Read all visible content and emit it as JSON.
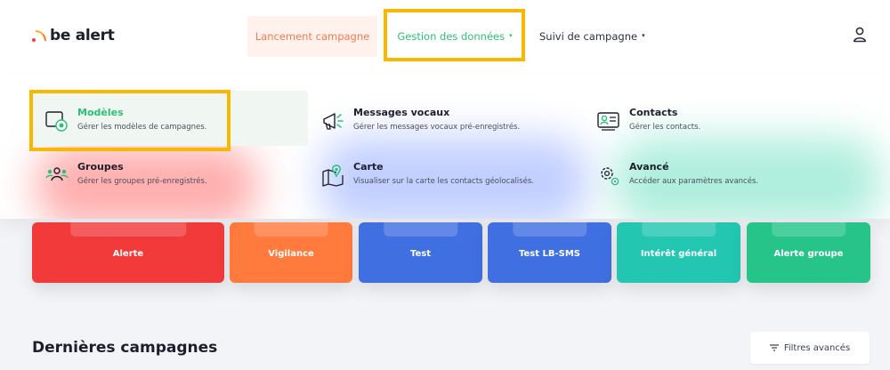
{
  "brand": {
    "logo_text": "be alert"
  },
  "nav": {
    "launch": "Lancement campagne",
    "data": "Gestion des données",
    "follow": "Suivi de campagne",
    "caret": "▾"
  },
  "menu": {
    "items": [
      {
        "title": "Modèles",
        "desc": "Gérer les modèles de campagnes.",
        "icon": "templates-icon"
      },
      {
        "title": "Messages vocaux",
        "desc": "Gérer les messages vocaux pré-enregistrés.",
        "icon": "megaphone-icon"
      },
      {
        "title": "Contacts",
        "desc": "Gérer les contacts.",
        "icon": "contact-card-icon"
      },
      {
        "title": "Groupes",
        "desc": "Gérer les groupes pré-enregistrés.",
        "icon": "group-icon"
      },
      {
        "title": "Carte",
        "desc": "Visualiser sur la carte les contacts géolocalisés.",
        "icon": "map-pin-icon"
      },
      {
        "title": "Avancé",
        "desc": "Accéder aux paramètres avancés.",
        "icon": "gear-icon"
      }
    ]
  },
  "cards": [
    {
      "label": "Alerte",
      "color": "#f23a3a"
    },
    {
      "label": "Vigilance",
      "color": "#ff7a3d"
    },
    {
      "label": "Test",
      "color": "#3f6fe0"
    },
    {
      "label": "Test LB-SMS",
      "color": "#3f6fe0"
    },
    {
      "label": "Intérêt général",
      "color": "#23c6b0"
    },
    {
      "label": "Alerte groupe",
      "color": "#26c489"
    }
  ],
  "section": {
    "title": "Dernières campagnes"
  },
  "filters": {
    "label": "Filtres avancés"
  },
  "colors": {
    "accent_green": "#2cbf78",
    "accent_orange": "#f47a52",
    "highlight": "#f8b800"
  }
}
